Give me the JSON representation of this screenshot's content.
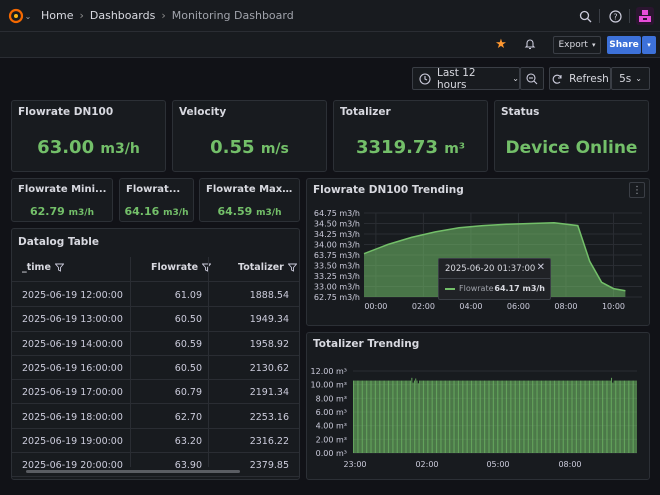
{
  "breadcrumb": {
    "home": "Home",
    "dashboards": "Dashboards",
    "current": "Monitoring Dashboard"
  },
  "toolbar": {
    "export_label": "Export",
    "share_label": "Share",
    "time_range": "Last 12 hours",
    "refresh_label": "Refresh",
    "refresh_interval": "5s"
  },
  "stats": {
    "flowrate_dn100": {
      "title": "Flowrate DN100",
      "value": "63.00",
      "unit": "m3/h"
    },
    "velocity": {
      "title": "Velocity",
      "value": "0.55",
      "unit": "m/s"
    },
    "totalizer": {
      "title": "Totalizer",
      "value": "3319.73",
      "unit": "m³"
    },
    "status": {
      "title": "Status",
      "value": "Device Online"
    },
    "flow_min": {
      "title": "Flowrate Mini...",
      "value": "62.79",
      "unit": "m3/h"
    },
    "flow_mean": {
      "title": "Flowrat...",
      "value": "64.16",
      "unit": "m3/h"
    },
    "flow_max": {
      "title": "Flowrate Maxi...",
      "value": "64.59",
      "unit": "m3/h"
    }
  },
  "table": {
    "title": "Datalog Table",
    "columns": [
      "_time",
      "Flowrate",
      "Totalizer"
    ],
    "rows": [
      [
        "2025-06-19 12:00:00",
        "61.09",
        "1888.54"
      ],
      [
        "2025-06-19 13:00:00",
        "60.50",
        "1949.34"
      ],
      [
        "2025-06-19 14:00:00",
        "60.59",
        "1958.92"
      ],
      [
        "2025-06-19 16:00:00",
        "60.50",
        "2130.62"
      ],
      [
        "2025-06-19 17:00:00",
        "60.79",
        "2191.34"
      ],
      [
        "2025-06-19 18:00:00",
        "62.70",
        "2253.16"
      ],
      [
        "2025-06-19 19:00:00",
        "63.20",
        "2316.22"
      ],
      [
        "2025-06-19 20:00:00",
        "63.90",
        "2379.85"
      ]
    ]
  },
  "colors": {
    "accent_green": "#73bf69",
    "share_blue": "#3d71d9",
    "star_orange": "#ff9830"
  },
  "icons": [
    "grafana-logo-icon",
    "search-icon",
    "help-icon",
    "rss-icon",
    "star-icon",
    "bell-icon",
    "clock-icon",
    "zoom-out-icon",
    "refresh-icon",
    "filter-icon",
    "menu-dots-icon"
  ],
  "chart_data": [
    {
      "type": "area",
      "title": "Flowrate DN100 Trending",
      "x_ticks": [
        "00:00",
        "02:00",
        "04:00",
        "06:00",
        "08:00",
        "10:00"
      ],
      "y_ticks": [
        "64.75 m3/h",
        "34.50 m3/h",
        "34.25 m3/h",
        "34.00 m3/h",
        "63.75 m3/h",
        "33.50 m3/h",
        "33.25 m3/h",
        "33.00 m3/h",
        "62.75 m3/h"
      ],
      "ylim": [
        62.75,
        64.75
      ],
      "series": [
        {
          "name": "Flowrate",
          "x": [
            "23:30",
            "00:30",
            "01:30",
            "02:30",
            "03:30",
            "04:30",
            "05:30",
            "06:30",
            "07:30",
            "08:30",
            "09:00",
            "09:30",
            "10:00",
            "10:30"
          ],
          "values": [
            63.78,
            64.0,
            64.17,
            64.3,
            64.4,
            64.45,
            64.48,
            64.5,
            64.52,
            64.45,
            63.6,
            63.1,
            62.95,
            62.9
          ]
        }
      ],
      "tooltip": {
        "time": "2025-06-20 01:37:00",
        "series": "Flowrate",
        "value": "64.17 m3/h"
      }
    },
    {
      "type": "bar",
      "title": "Totalizer Trending",
      "x_ticks": [
        "23:00",
        "02:00",
        "05:00",
        "08:00"
      ],
      "y_ticks": [
        "12.00 m³",
        "10.00 m³",
        "8.00 m³",
        "6.00 m³",
        "4.00 m³",
        "2.00 m³",
        "0.00 m³"
      ],
      "ylim": [
        0,
        12
      ],
      "values": [
        10.6,
        10.6,
        10.6,
        10.6,
        10.6,
        10.6,
        10.6,
        10.6,
        10.6,
        10.6,
        10.6,
        10.6,
        10.6,
        10.6,
        10.6,
        10.6,
        10.6,
        10.6,
        10.6,
        10.6,
        10.6,
        10.6,
        10.6,
        10.6,
        10.6,
        10.6,
        10.6,
        10.6,
        10.6,
        10.6,
        10.6,
        10.6,
        10.6,
        10.6,
        10.6,
        10.6,
        10.6,
        10.6,
        10.6,
        10.6,
        10.6,
        10.6,
        10.6,
        10.6,
        10.6,
        11.0,
        10.3,
        10.6,
        10.9,
        10.6,
        10.2,
        10.6,
        10.6,
        10.6,
        10.6,
        10.6,
        10.6,
        10.6,
        10.6,
        10.6,
        10.6,
        10.6,
        10.6,
        10.6,
        10.6,
        10.6,
        10.6,
        10.6,
        10.6,
        10.6,
        10.6,
        10.6,
        10.6,
        10.6,
        10.6,
        10.6,
        10.6,
        10.6,
        10.6,
        10.6,
        10.6,
        10.6,
        10.6,
        10.6,
        10.6,
        10.6,
        10.6,
        10.6,
        10.6,
        10.6,
        10.6,
        10.6,
        10.6,
        10.6,
        10.6,
        10.6,
        10.6,
        10.6,
        10.6,
        10.6,
        10.6,
        10.6,
        10.6,
        10.6,
        10.6,
        10.6,
        10.6,
        10.6,
        10.6,
        10.6,
        10.6,
        10.6,
        10.6,
        10.6,
        10.6,
        10.6,
        10.6,
        10.6,
        10.6,
        10.6,
        10.6,
        10.6,
        10.6,
        10.6,
        10.6,
        10.6,
        10.6,
        10.6,
        10.6,
        10.6,
        10.6,
        10.6,
        10.6,
        10.6,
        10.6,
        10.6,
        10.6,
        10.6,
        10.6,
        10.6,
        10.6,
        10.6,
        10.6,
        10.6,
        10.6,
        10.6,
        10.6,
        10.6,
        10.6,
        10.6,
        10.6,
        10.6,
        10.6,
        10.6,
        10.6,
        10.6,
        10.6,
        10.6,
        10.6,
        10.6,
        10.6,
        10.6,
        10.6,
        10.6,
        10.6,
        10.6,
        10.6,
        10.6,
        10.6,
        10.6,
        10.6,
        10.6,
        10.6,
        10.6,
        10.6,
        10.6,
        10.6,
        10.6,
        10.6,
        10.6,
        10.6,
        10.6,
        10.6,
        10.6,
        10.6,
        10.6,
        10.6,
        10.6,
        10.6,
        10.6,
        10.6,
        10.6,
        10.6,
        10.6,
        10.6,
        10.6,
        10.6,
        10.6,
        10.6,
        11.0,
        10.3,
        10.6,
        10.6,
        10.6,
        10.6,
        10.6,
        10.6,
        10.6,
        10.6,
        10.6,
        10.6,
        10.6,
        10.6,
        10.6,
        10.6,
        10.6,
        10.6,
        10.6,
        10.6
      ]
    }
  ]
}
